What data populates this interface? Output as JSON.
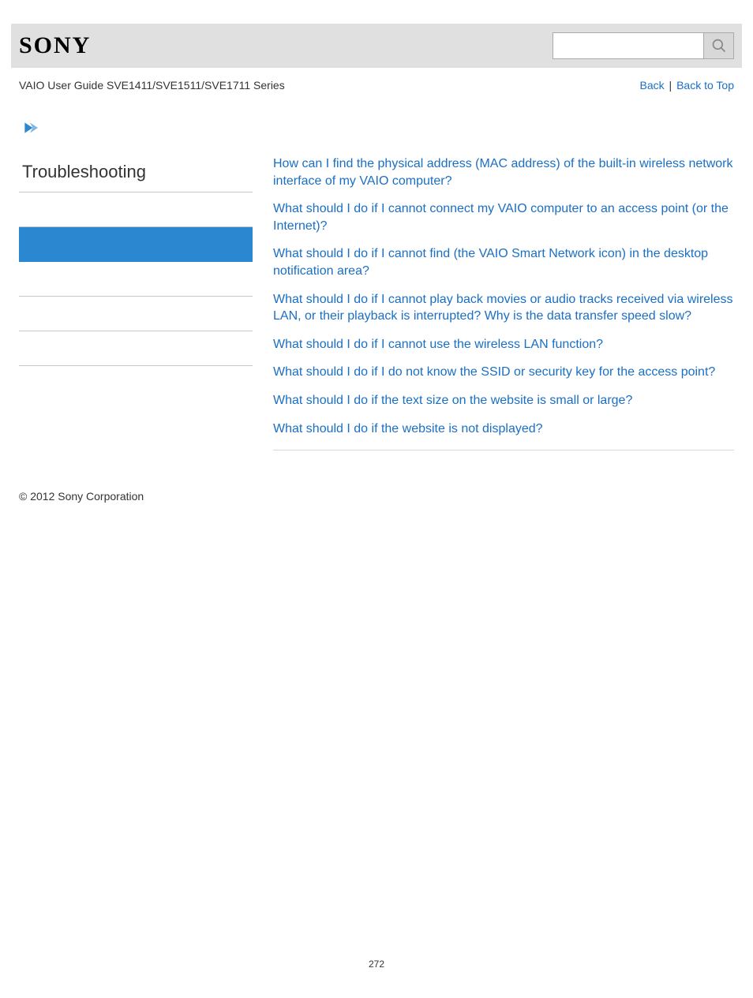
{
  "header": {
    "logo": "SONY",
    "search_placeholder": ""
  },
  "subheader": {
    "title": "VAIO User Guide SVE1411/SVE1511/SVE1711 Series",
    "back": "Back",
    "sep": " | ",
    "back_to_top": "Back to Top"
  },
  "sidebar": {
    "heading": "Troubleshooting"
  },
  "questions": [
    "How can I find the physical address (MAC address) of the built-in wireless network interface of my VAIO computer?",
    "What should I do if I cannot connect my VAIO computer to an access point (or the Internet)?",
    "What should I do if I cannot find (the VAIO Smart Network icon) in the desktop notification area?",
    "What should I do if I cannot play back movies or audio tracks received via wireless LAN, or their playback is interrupted? Why is the data transfer speed slow?",
    "What should I do if I cannot use the wireless LAN function?",
    "What should I do if I do not know the SSID or security key for the access point?",
    "What should I do if the text size on the website is small or large?",
    "What should I do if the website is not displayed?"
  ],
  "footer": {
    "copyright": "© 2012 Sony Corporation"
  },
  "page_number": "272"
}
